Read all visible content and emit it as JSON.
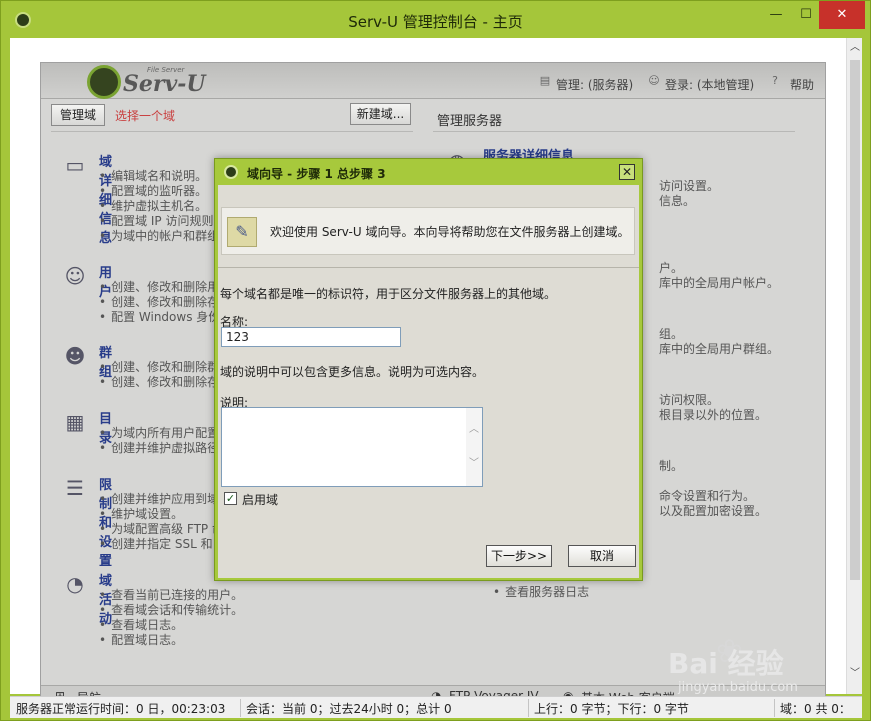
{
  "window": {
    "title": "Serv-U 管理控制台 - 主页",
    "min_glyph": "—",
    "max_glyph": "☐",
    "close_glyph": "✕"
  },
  "scrollbar": {
    "up": "︿",
    "down": "﹀"
  },
  "header": {
    "logo_small": "File Server",
    "logo_text": "Serv-U",
    "manage_link": "管理: (服务器)",
    "login_link": "登录: (本地管理)",
    "help_link": "帮助"
  },
  "left_panel": {
    "heading": "管理域",
    "select_hint": "选择一个域",
    "new_domain_button": "新建域...",
    "sections": [
      {
        "title": "域详细信息",
        "items": [
          "编辑域名和说明。",
          "配置域的监听器。",
          "维护虚拟主机名。",
          "配置域 IP 访问规则",
          "为域中的帐户和群组"
        ]
      },
      {
        "title": "用户",
        "items": [
          "创建、修改和删除用",
          "创建、修改和删除存",
          "配置 Windows 身份"
        ]
      },
      {
        "title": "群组",
        "items": [
          "创建、修改和删除群",
          "创建、修改和删除存"
        ]
      },
      {
        "title": "目录",
        "items": [
          "为域内所有用户配置",
          "创建并维护虚拟路径"
        ]
      },
      {
        "title": "限制和设置",
        "items": [
          "创建并维护应用到域",
          "维护域设置。",
          "为域配置高级 FTP 命",
          "创建并指定 SSL 和"
        ]
      },
      {
        "title": "域活动",
        "items": [
          "查看当前已连接的用户。",
          "查看域会话和传输统计。",
          "查看域日志。",
          "配置域日志。"
        ]
      }
    ]
  },
  "right_panel": {
    "heading": "管理服务器",
    "section_title": "服务器详细信息",
    "fragments": [
      "访问设置。",
      "信息。",
      "户。",
      "库中的全局用户帐户。",
      "组。",
      "库中的全局用户群组。",
      "访问权限。",
      "根目录以外的位置。",
      "制。",
      "命令设置和行为。",
      "以及配置加密设置。"
    ],
    "log_item": "查看服务器日志"
  },
  "bottom_bar": {
    "nav_label": "导航",
    "ftp_label": "FTP Voyager JV",
    "web_label": "基本 Web 客户端"
  },
  "status_bar": {
    "uptime": "服务器正常运行时间：0 日，00:23:03",
    "sessions": "会话：当前 0；过去24小时 0；总计 0",
    "transfer": "上行：0 字节；下行：0 字节",
    "domains": "域：0 共 0："
  },
  "watermark": {
    "brand": "Bai  经验",
    "url": "jingyan.baidu.com"
  },
  "dialog": {
    "title": "域向导 - 步骤 1 总步骤 3",
    "close_glyph": "✕",
    "welcome": "欢迎使用 Serv-U 域向导。本向导将帮助您在文件服务器上创建域。",
    "intro": "每个域名都是唯一的标识符，用于区分文件服务器上的其他域。",
    "name_label": "名称:",
    "name_value": "123",
    "desc_hint": "域的说明中可以包含更多信息。说明为可选内容。",
    "desc_label": "说明:",
    "desc_value": "",
    "enable_label": "启用域",
    "enable_checked": true,
    "check_glyph": "✓",
    "next_button": "下一步>>",
    "cancel_button": "取消"
  }
}
